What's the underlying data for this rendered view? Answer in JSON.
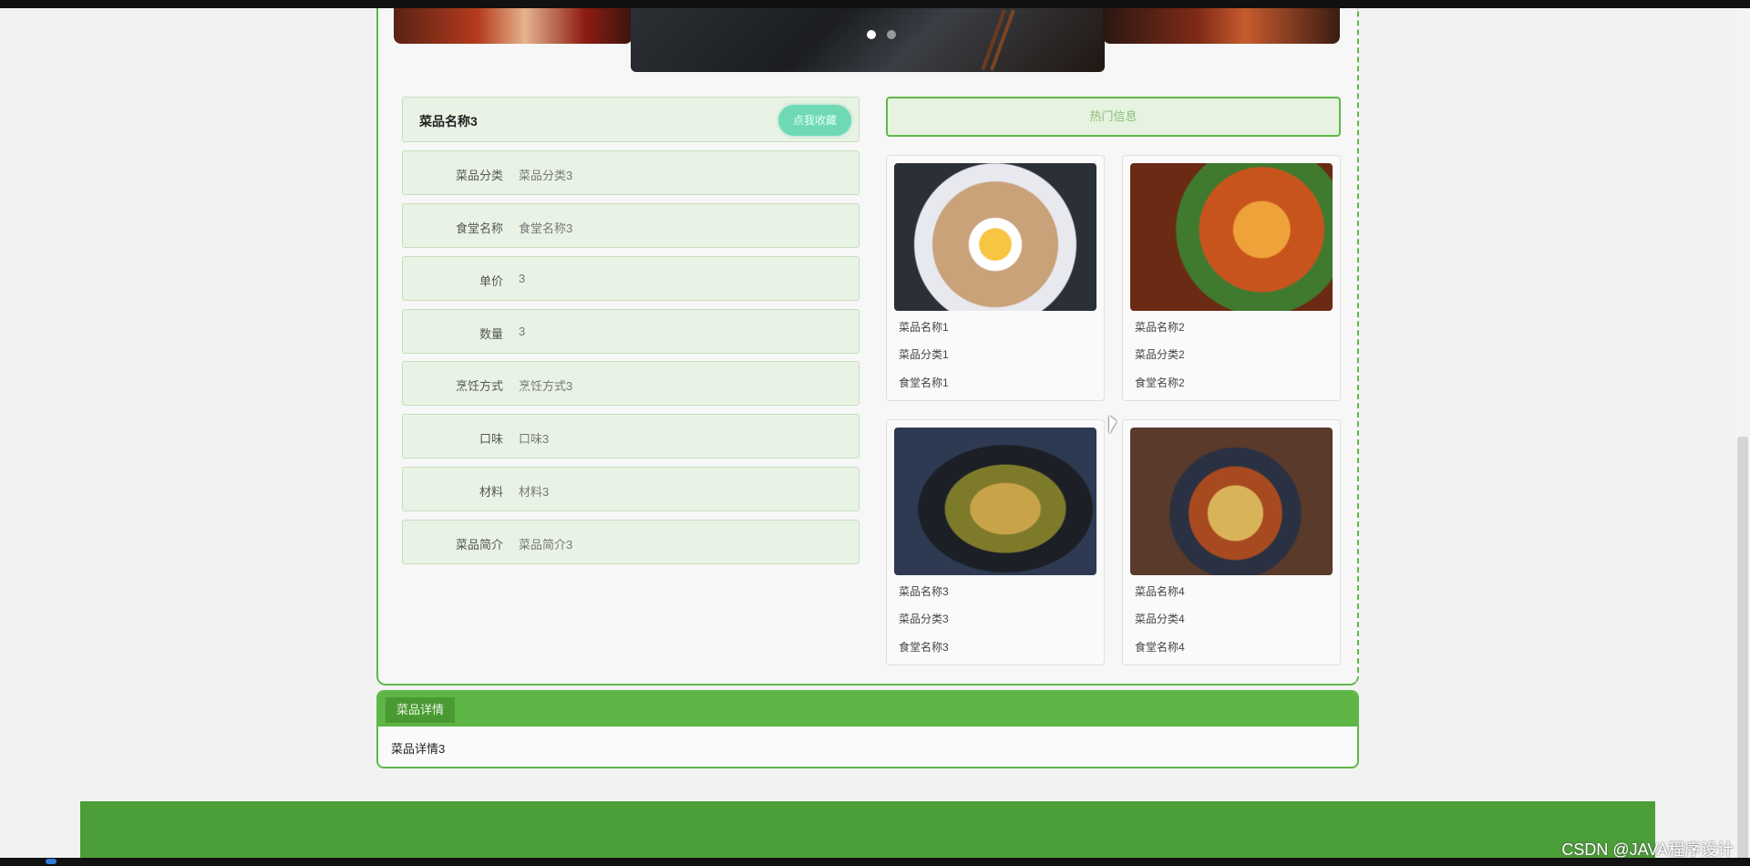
{
  "banner": {
    "active_slide": 1,
    "slide_count": 2
  },
  "dish": {
    "name": "菜品名称3",
    "favorite_label": "点我收藏",
    "fields": [
      {
        "label": "菜品分类",
        "value": "菜品分类3"
      },
      {
        "label": "食堂名称",
        "value": "食堂名称3"
      },
      {
        "label": "单价",
        "value": "3"
      },
      {
        "label": "数量",
        "value": "3"
      },
      {
        "label": "烹饪方式",
        "value": "烹饪方式3"
      },
      {
        "label": "口味",
        "value": "口味3"
      },
      {
        "label": "材料",
        "value": "材料3"
      },
      {
        "label": "菜品简介",
        "value": "菜品简介3"
      }
    ]
  },
  "hot": {
    "title": "热门信息",
    "items": [
      {
        "name": "菜品名称1",
        "category": "菜品分类1",
        "canteen": "食堂名称1"
      },
      {
        "name": "菜品名称2",
        "category": "菜品分类2",
        "canteen": "食堂名称2"
      },
      {
        "name": "菜品名称3",
        "category": "菜品分类3",
        "canteen": "食堂名称3"
      },
      {
        "name": "菜品名称4",
        "category": "菜品分类4",
        "canteen": "食堂名称4"
      }
    ]
  },
  "detail": {
    "tab_label": "菜品详情",
    "content": "菜品详情3"
  },
  "watermark": "CSDN @JAVA程序设计",
  "colors": {
    "accent": "#5cb544",
    "card_bg": "#e9f3e5",
    "favorite": "#6fd9b6"
  }
}
